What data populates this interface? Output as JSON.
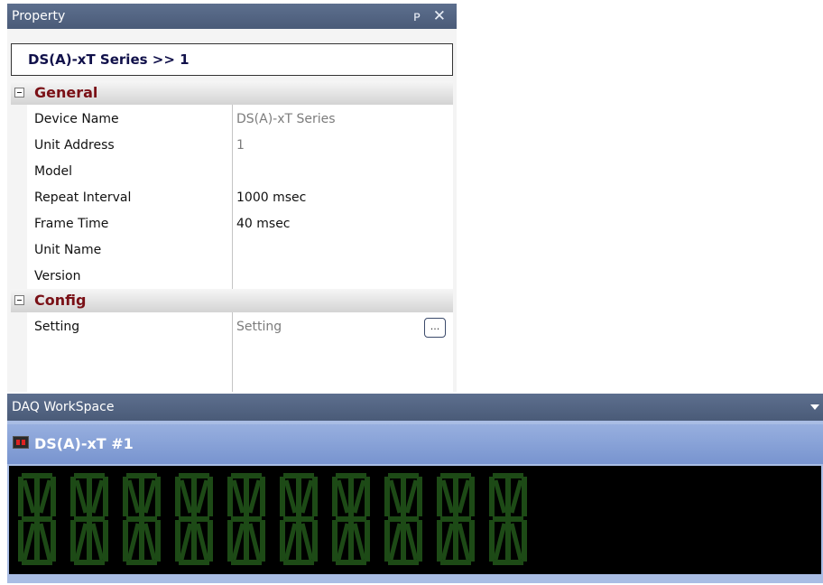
{
  "property_panel": {
    "title": "Property",
    "pin_glyph": "ᴩ",
    "close_glyph": "✕",
    "object_label": "DS(A)-xT Series >> 1",
    "categories": [
      {
        "label": "General",
        "rows": [
          {
            "name": "Device Name",
            "value": "DS(A)-xT Series"
          },
          {
            "name": "Unit Address",
            "value": "1"
          },
          {
            "name": "Model",
            "value": ""
          },
          {
            "name": "Repeat Interval",
            "value": "1000 msec"
          },
          {
            "name": "Frame Time",
            "value": "40 msec"
          },
          {
            "name": "Unit Name",
            "value": ""
          },
          {
            "name": "Version",
            "value": ""
          }
        ]
      },
      {
        "label": "Config",
        "rows": [
          {
            "name": "Setting",
            "value": "Setting",
            "button": "..."
          }
        ]
      }
    ]
  },
  "workspace": {
    "title": "DAQ WorkSpace",
    "device_title": "DS(A)-xT #1",
    "display_digits": 10,
    "display_color": "#1d4a16"
  }
}
